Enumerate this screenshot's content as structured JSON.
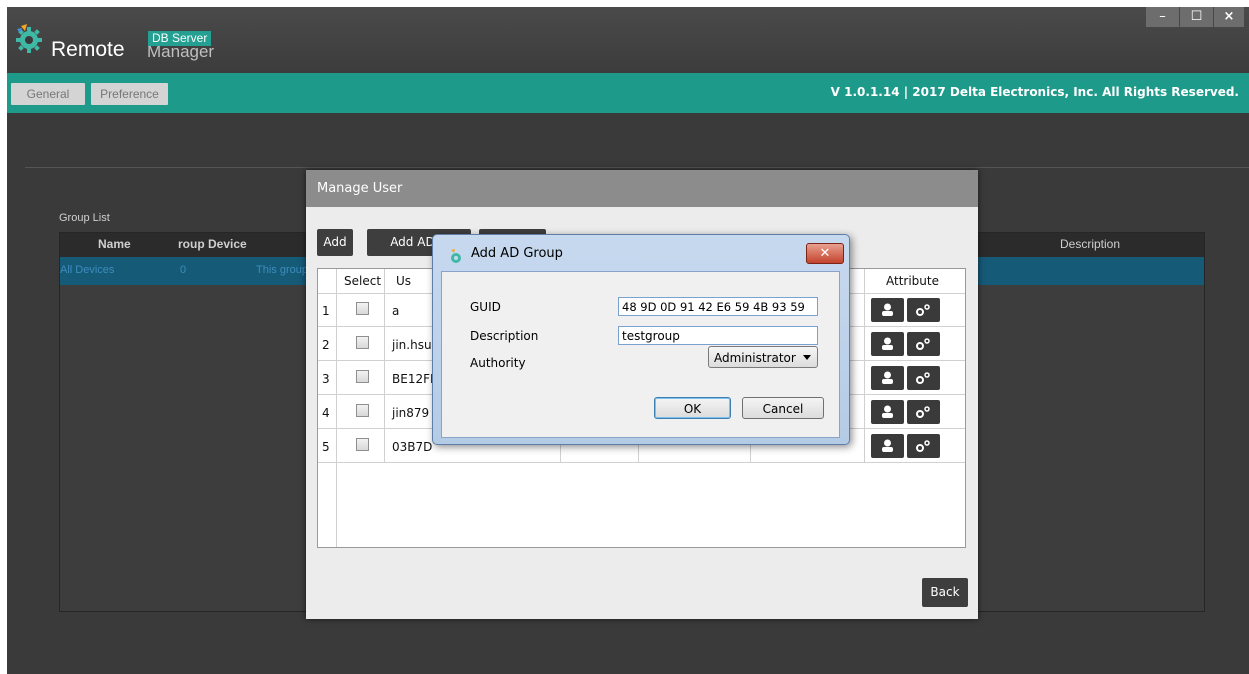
{
  "app": {
    "badge": "DB Server",
    "brand_remote": "Remote",
    "brand_manager": "Manager",
    "window_controls": {
      "minimize": "–",
      "maximize": "☐",
      "close": "×"
    }
  },
  "menu": {
    "general": "General",
    "preference": "Preference",
    "version": "V 1.0.1.14  |  2017 Delta Electronics, Inc. All Rights Reserved."
  },
  "group_list": {
    "label": "Group List",
    "headers": [
      "Name",
      "roup Device",
      "Description"
    ],
    "row": [
      "All Devices",
      "0",
      "This group"
    ]
  },
  "manage_user": {
    "title": "Manage User",
    "buttons": {
      "add": "Add",
      "add_ad_group": "Add AD G",
      "back": "Back"
    },
    "headers": {
      "select": "Select",
      "user": "Us",
      "attribute": "Attribute"
    },
    "rows": [
      {
        "num": "1",
        "user": "a"
      },
      {
        "num": "2",
        "user": "jin.hsu"
      },
      {
        "num": "3",
        "user": "BE12FI"
      },
      {
        "num": "4",
        "user": "jin879"
      },
      {
        "num": "5",
        "user": "03B7D"
      }
    ]
  },
  "add_ad_group": {
    "title": "Add AD Group",
    "close": "✕",
    "guid_label": "GUID",
    "guid_value": "48 9D 0D 91 42 E6 59 4B 93 59",
    "description_label": "Description",
    "description_value": "testgroup",
    "authority_label": "Authority",
    "authority_value": "Administrator",
    "ok": "OK",
    "cancel": "Cancel"
  },
  "colors": {
    "teal": "#1d9a8a",
    "dark_bg": "#3a3a3a",
    "selected_row": "#155a77"
  }
}
